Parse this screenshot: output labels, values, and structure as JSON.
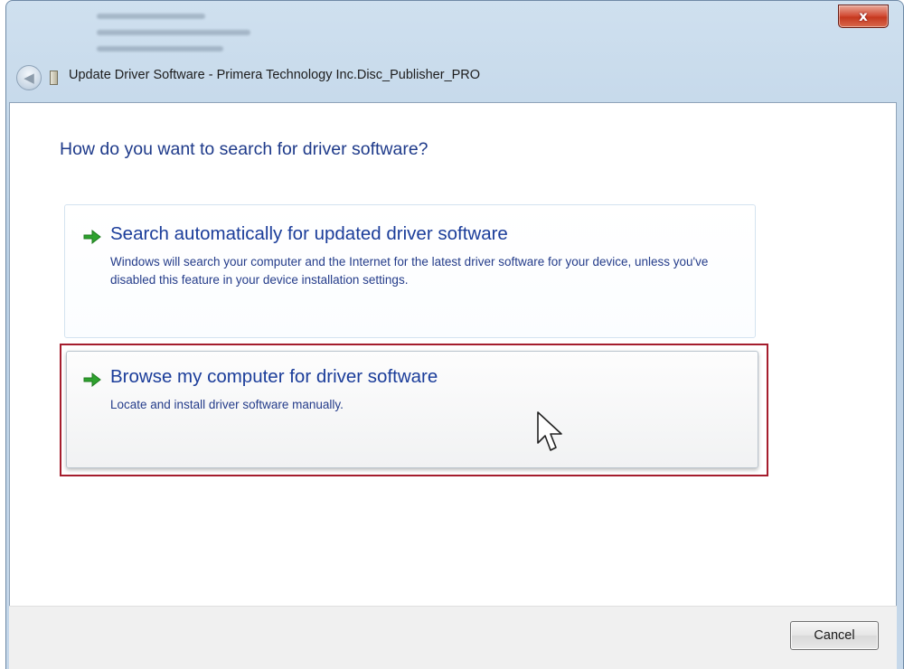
{
  "window": {
    "title": "Update Driver Software - Primera Technology Inc.Disc_Publisher_PRO",
    "close_glyph": "x"
  },
  "content": {
    "heading": "How do you want to search for driver software?",
    "options": [
      {
        "title": "Search automatically for updated driver software",
        "description": "Windows will search your computer and the Internet for the latest driver software for your device, unless you've disabled this feature in your device installation settings.",
        "icon": "green-arrow-icon"
      },
      {
        "title": "Browse my computer for driver software",
        "description": "Locate and install driver software manually.",
        "icon": "green-arrow-icon",
        "state": "hover"
      }
    ]
  },
  "footer": {
    "cancel_label": "Cancel"
  },
  "colors": {
    "heading_text": "#1e3a8a",
    "option_text": "#1b3d9a",
    "arrow_green": "#2ea22e",
    "highlight_border": "#a51d2d",
    "close_button": "#c5381f"
  }
}
